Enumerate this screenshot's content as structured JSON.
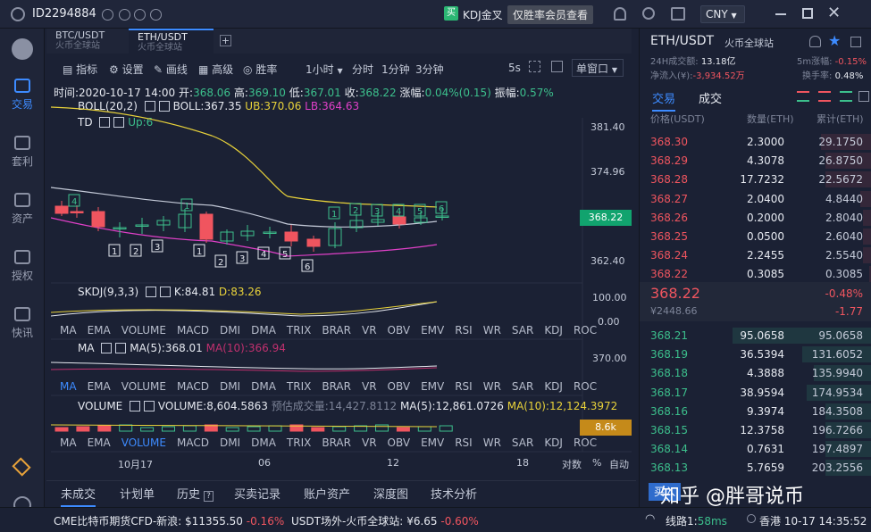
{
  "topbar": {
    "uid": "ID2294884",
    "kdj_badge": "买",
    "kdj_text": "KDJ金叉",
    "vip_text": "仅胜率会员查看",
    "currency": "CNY"
  },
  "leftnav": [
    {
      "label": "交易",
      "icon": "trade-icon",
      "active": true
    },
    {
      "label": "套利",
      "icon": "arbitrage-icon"
    },
    {
      "label": "资产",
      "icon": "assets-icon"
    },
    {
      "label": "授权",
      "icon": "auth-icon"
    },
    {
      "label": "快讯",
      "icon": "news-icon"
    }
  ],
  "pair_tabs": [
    {
      "pair": "BTC/USDT",
      "exchange": "火币全球站"
    },
    {
      "pair": "ETH/USDT",
      "exchange": "火币全球站",
      "active": true
    }
  ],
  "toolbar": {
    "indicator": "指标",
    "settings": "设置",
    "draw": "画线",
    "advanced": "高级",
    "winrate": "胜率",
    "period": "1小时",
    "minute": "分时",
    "m1": "1分钟",
    "m3": "3分钟",
    "refresh": "5s",
    "window": "单窗口"
  },
  "ohlc_bar": {
    "time_label": "时间:",
    "time": "2020-10-17 14:00",
    "open_label": "开:",
    "open": "368.06",
    "high_label": "高:",
    "high": "369.10",
    "low_label": "低:",
    "low": "367.01",
    "close_label": "收:",
    "close": "368.22",
    "change_label": "涨幅:",
    "change": "0.04%(0.15)",
    "amp_label": "振幅:",
    "amp": "0.57%"
  },
  "boll": {
    "name": "BOLL(20,2)",
    "mid": "BOLL:367.35",
    "ub": "UB:370.06",
    "lb": "LB:364.63"
  },
  "td": {
    "name": "TD",
    "up": "Up:6"
  },
  "price_axis": [
    "381.40",
    "374.96",
    "362.40"
  ],
  "current_price_tag": "368.22",
  "skdj": {
    "name": "SKDJ(9,3,3)",
    "k": "K:84.81",
    "d": "D:83.26",
    "axis": [
      "100.00",
      "0.00"
    ]
  },
  "ma": {
    "name": "MA",
    "ma5": "MA(5):368.01",
    "ma10": "MA(10):366.94",
    "axis": "370.00"
  },
  "volume": {
    "name": "VOLUME",
    "vol": "VOLUME:8,604.5863",
    "est": "预估成交量:14,427.8112",
    "ma5": "MA(5):12,861.0726",
    "ma10": "MA(10):12,124.3972",
    "tag": "8.6k"
  },
  "indicator_tabs": [
    "MA",
    "EMA",
    "VOLUME",
    "MACD",
    "DMI",
    "DMA",
    "TRIX",
    "BRAR",
    "VR",
    "OBV",
    "EMV",
    "RSI",
    "WR",
    "SAR",
    "KDJ",
    "ROC"
  ],
  "time_axis": [
    "10月17",
    "06",
    "12",
    "18"
  ],
  "scale_opts": [
    "对数",
    "%",
    "自动"
  ],
  "chart_data": {
    "type": "candlestick",
    "interval": "1小时",
    "candles_visible": 18,
    "last_close": 368.22,
    "ylim": [
      360,
      382
    ]
  },
  "td_numbers_up": [
    "4",
    "1",
    "2",
    "3",
    "4",
    "5",
    "6"
  ],
  "td_numbers_down": [
    "1",
    "2",
    "3",
    "1",
    "2",
    "3",
    "4",
    "5",
    "6"
  ],
  "orderbook": {
    "pair": "ETH/USDT",
    "exchange": "火币全球站",
    "vol_label": "24H成交额:",
    "vol": "13.18亿",
    "change5m_label": "5m涨幅:",
    "change5m": "-0.15%",
    "netflow_label": "净流入(¥):",
    "netflow": "-3,934.52万",
    "turnover_label": "换手率:",
    "turnover": "0.48%",
    "tab_trade": "交易",
    "tab_deal": "成交",
    "headers": {
      "price": "价格(USDT)",
      "qty": "数量(ETH)",
      "total": "累计(ETH)"
    },
    "asks": [
      {
        "p": "368.30",
        "q": "2.3000",
        "t": "29.1750",
        "w": 0.22
      },
      {
        "p": "368.29",
        "q": "4.3078",
        "t": "26.8750",
        "w": 0.2
      },
      {
        "p": "368.28",
        "q": "17.7232",
        "t": "22.5672",
        "w": 0.2
      },
      {
        "p": "368.27",
        "q": "2.0400",
        "t": "4.8440",
        "w": 0.05
      },
      {
        "p": "368.26",
        "q": "0.2000",
        "t": "2.8040",
        "w": 0.04
      },
      {
        "p": "368.25",
        "q": "0.0500",
        "t": "2.6040",
        "w": 0.04
      },
      {
        "p": "368.24",
        "q": "2.2455",
        "t": "2.5540",
        "w": 0.04
      },
      {
        "p": "368.22",
        "q": "0.3085",
        "t": "0.3085",
        "w": 0.01
      }
    ],
    "last_price": "368.22",
    "last_cny": "¥2448.66",
    "last_pct": "-0.48%",
    "last_diff": "-1.77",
    "bids": [
      {
        "p": "368.21",
        "q": "95.0658",
        "t": "95.0658",
        "w": 0.6
      },
      {
        "p": "368.19",
        "q": "36.5394",
        "t": "131.6052",
        "w": 0.3
      },
      {
        "p": "368.18",
        "q": "4.3888",
        "t": "135.9940",
        "w": 0.25
      },
      {
        "p": "368.17",
        "q": "38.9594",
        "t": "174.9534",
        "w": 0.28
      },
      {
        "p": "368.16",
        "q": "9.3974",
        "t": "184.3508",
        "w": 0.2
      },
      {
        "p": "368.15",
        "q": "12.3758",
        "t": "196.7266",
        "w": 0.2
      },
      {
        "p": "368.14",
        "q": "0.7631",
        "t": "197.4897",
        "w": 0.2
      },
      {
        "p": "368.13",
        "q": "5.7659",
        "t": "203.2556",
        "w": 0.2
      }
    ],
    "buy_button": "买入"
  },
  "bottom_tabs": [
    "未成交",
    "计划单",
    "历史",
    "买卖记录",
    "账户资产",
    "深度图",
    "技术分析"
  ],
  "status": {
    "cme": "CME比特币期货CFD-新浪:",
    "cme_price": "$11355.50",
    "cme_pct": "-0.16%",
    "otc": "USDT场外-火币全球站:",
    "otc_price": "¥6.65",
    "otc_pct": "-0.60%",
    "line": "线路1:",
    "latency": "58ms",
    "region": "香港",
    "time": "10-17 14:35:52"
  },
  "watermark": "知乎 @胖哥说币"
}
